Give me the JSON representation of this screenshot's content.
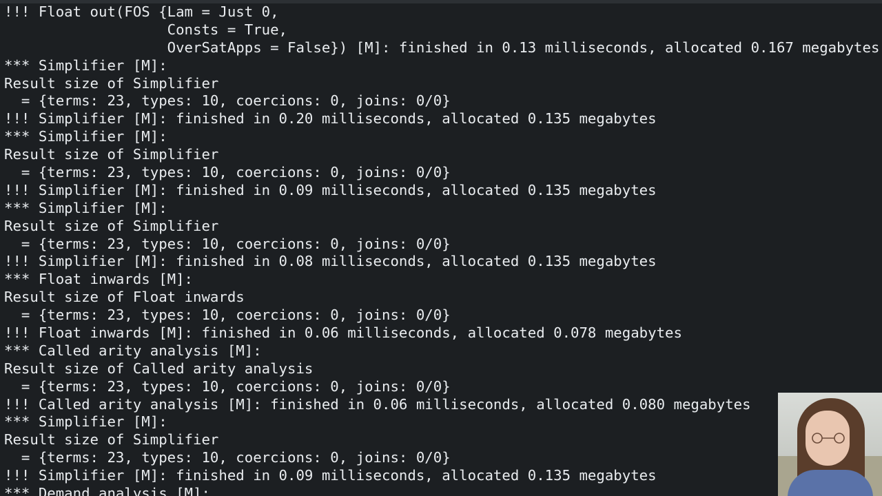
{
  "terminal": {
    "lines": [
      "!!! Float out(FOS {Lam = Just 0,",
      "                   Consts = True,",
      "                   OverSatApps = False}) [M]: finished in 0.13 milliseconds, allocated 0.167 megabytes",
      "*** Simplifier [M]:",
      "Result size of Simplifier",
      "  = {terms: 23, types: 10, coercions: 0, joins: 0/0}",
      "!!! Simplifier [M]: finished in 0.20 milliseconds, allocated 0.135 megabytes",
      "*** Simplifier [M]:",
      "Result size of Simplifier",
      "  = {terms: 23, types: 10, coercions: 0, joins: 0/0}",
      "!!! Simplifier [M]: finished in 0.09 milliseconds, allocated 0.135 megabytes",
      "*** Simplifier [M]:",
      "Result size of Simplifier",
      "  = {terms: 23, types: 10, coercions: 0, joins: 0/0}",
      "!!! Simplifier [M]: finished in 0.08 milliseconds, allocated 0.135 megabytes",
      "*** Float inwards [M]:",
      "Result size of Float inwards",
      "  = {terms: 23, types: 10, coercions: 0, joins: 0/0}",
      "!!! Float inwards [M]: finished in 0.06 milliseconds, allocated 0.078 megabytes",
      "*** Called arity analysis [M]:",
      "Result size of Called arity analysis",
      "  = {terms: 23, types: 10, coercions: 0, joins: 0/0}",
      "!!! Called arity analysis [M]: finished in 0.06 milliseconds, allocated 0.080 megabytes",
      "*** Simplifier [M]:",
      "Result size of Simplifier",
      "  = {terms: 23, types: 10, coercions: 0, joins: 0/0}",
      "!!! Simplifier [M]: finished in 0.09 milliseconds, allocated 0.135 megabytes",
      "*** Demand analysis [M]:"
    ]
  },
  "colors": {
    "background": "#1c1f22",
    "text": "#e9ecef"
  }
}
